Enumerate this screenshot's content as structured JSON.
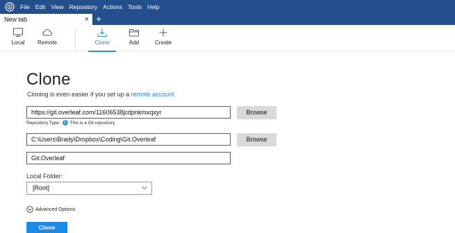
{
  "menubar": {
    "items": [
      "File",
      "Edit",
      "View",
      "Repository",
      "Actions",
      "Tools",
      "Help"
    ]
  },
  "tabs": {
    "active_label": "New tab",
    "close_glyph": "×",
    "add_glyph": "+"
  },
  "toolbar": {
    "local": "Local",
    "remote": "Remote",
    "clone": "Clone",
    "add": "Add",
    "create": "Create"
  },
  "main": {
    "title": "Clone",
    "subtitle_prefix": "Cloning is even easier if you set up a ",
    "subtitle_link": "remote account",
    "source_url": "https://git.overleaf.com/11606538jcdpnkmxqxyr",
    "repo_type_label": "Repository Type:",
    "repo_type_value": "This is a Git repository",
    "destination_path": "C:\\Users\\Brady\\Dropbox\\Coding\\Git.Overleaf",
    "name": "Git.Overleaf",
    "browse_label": "Browse",
    "local_folder_label": "Local Folder:",
    "local_folder_value": "[Root]",
    "advanced_options": "Advanced Options",
    "clone_button": "Clone"
  },
  "colors": {
    "menubar": "#23508c",
    "accent": "#1e88e5",
    "link": "#1e7fd8"
  }
}
